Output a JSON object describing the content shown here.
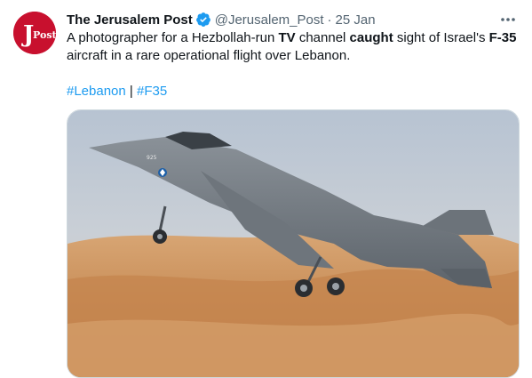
{
  "tweet": {
    "author_name": "The Jerusalem Post",
    "handle": "@Jerusalem_Post",
    "separator": "·",
    "date": "25 Jan",
    "text_parts": [
      "A photographer for a Hezbollah-run ",
      "TV",
      " channel ",
      "caught",
      " sight of Israel's ",
      "F-35",
      " aircraft in a rare operational flight over Lebanon."
    ],
    "hashtags": [
      "#Lebanon",
      "#F35"
    ],
    "hashtag_separator": "|",
    "avatar_logo_text": "JPost",
    "aircraft_tail_number": "925"
  },
  "icons": {
    "verified": "verified-badge-icon",
    "more": "more-options-icon"
  },
  "colors": {
    "brand_red": "#c8102e",
    "link_blue": "#1d9bf0",
    "secondary_text": "#536471",
    "verified_blue": "#1d9bf0"
  }
}
